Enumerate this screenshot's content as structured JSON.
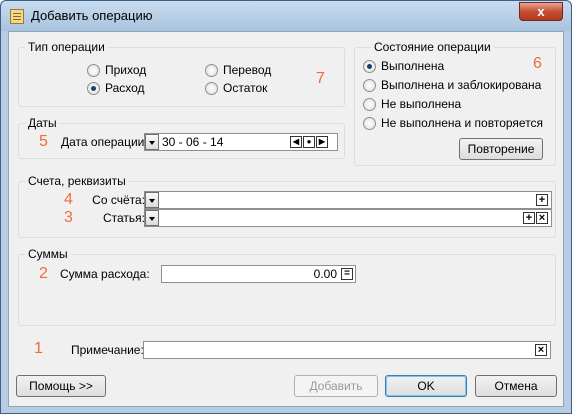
{
  "window": {
    "title": "Добавить операцию",
    "close_label": "x"
  },
  "operation_type": {
    "title": "Тип операции",
    "options": [
      {
        "label": "Приход",
        "checked": false
      },
      {
        "label": "Перевод",
        "checked": false
      },
      {
        "label": "Расход",
        "checked": true
      },
      {
        "label": "Остаток",
        "checked": false
      }
    ],
    "marker": "7"
  },
  "operation_state": {
    "title": "Состояние операции",
    "options": [
      {
        "label": "Выполнена",
        "checked": true
      },
      {
        "label": "Выполнена и заблокирована",
        "checked": false
      },
      {
        "label": "Не выполнена",
        "checked": false
      },
      {
        "label": "Не выполнена и повторяется",
        "checked": false
      }
    ],
    "repeat_button": "Повторение",
    "marker": "6"
  },
  "dates": {
    "title": "Даты",
    "marker": "5",
    "date_label": "Дата операции:",
    "date_value": "30 - 06 - 14"
  },
  "accounts": {
    "title": "Счета, реквизиты",
    "from_marker": "4",
    "from_label": "Со счёта:",
    "from_value": "",
    "article_marker": "3",
    "article_label": "Статья:",
    "article_value": ""
  },
  "sums": {
    "title": "Суммы",
    "marker": "2",
    "expense_label": "Сумма расхода:",
    "expense_value": "0.00"
  },
  "note": {
    "marker": "1",
    "label": "Примечание:",
    "value": ""
  },
  "footer": {
    "help": "Помощь >>",
    "add": "Добавить",
    "ok": "OK",
    "cancel": "Отмена"
  }
}
